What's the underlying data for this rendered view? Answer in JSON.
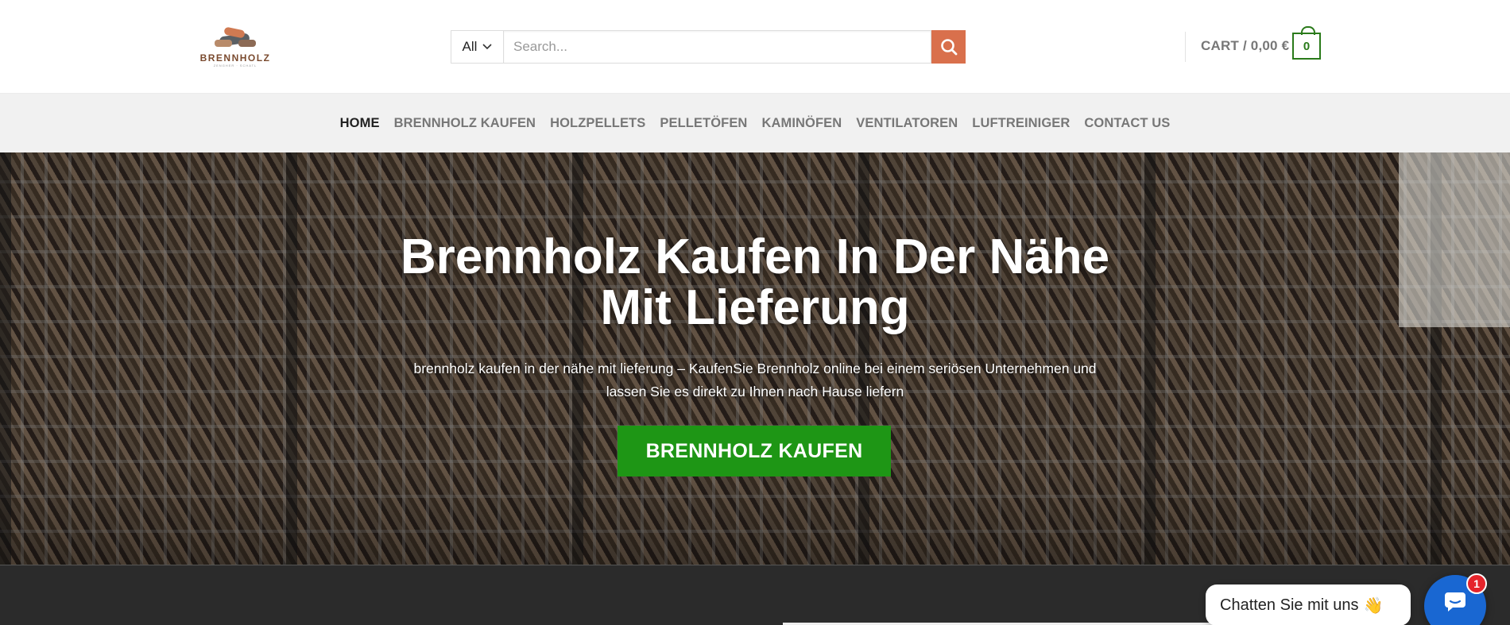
{
  "header": {
    "logo": {
      "text": "BRENNHOLZ",
      "sub": "ZENGHER · SCHATL"
    },
    "search": {
      "category": "All",
      "placeholder": "Search..."
    },
    "cart": {
      "label": "CART / 0,00 €",
      "count": "0"
    }
  },
  "nav": {
    "items": [
      {
        "label": "HOME",
        "active": true
      },
      {
        "label": "BRENNHOLZ KAUFEN"
      },
      {
        "label": "HOLZPELLETS"
      },
      {
        "label": "PELLETÖFEN"
      },
      {
        "label": "KAMINÖFEN"
      },
      {
        "label": "VENTILATOREN"
      },
      {
        "label": "LUFTREINIGER"
      },
      {
        "label": "CONTACT US"
      }
    ]
  },
  "hero": {
    "title_line1": "Brennholz Kaufen In Der Nähe",
    "title_line2": "Mit Lieferung",
    "subtitle_line1": "brennholz kaufen in der nähe mit lieferung – KaufenSie Brennholz online bei einem seriösen Unternehmen und",
    "subtitle_line2": "lassen Sie es direkt zu Ihnen nach Hause liefern",
    "cta": "BRENNHOLZ KAUFEN"
  },
  "chat": {
    "bubble_text": "Chatten Sie mit uns",
    "emoji": "👋",
    "badge": "1"
  },
  "colors": {
    "accent_green": "#1e9615",
    "search_button": "#d9704c",
    "cart_green": "#2a7a1a",
    "chat_blue": "#1967d2",
    "badge_red": "#e5242b"
  },
  "icons": [
    "brand-logo-icon",
    "chevron-down-icon",
    "search-icon",
    "cart-icon",
    "chat-icon"
  ]
}
